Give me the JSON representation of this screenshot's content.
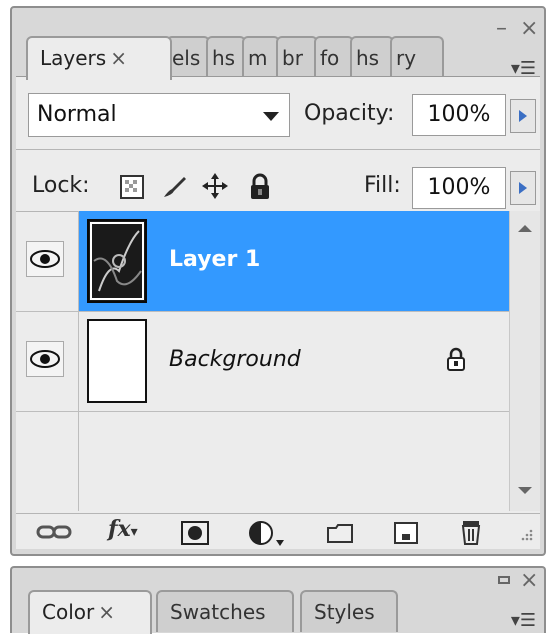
{
  "layers_panel": {
    "tabs": [
      {
        "label": "Layers",
        "active": true
      },
      {
        "label": "els"
      },
      {
        "label": "hs"
      },
      {
        "label": "m"
      },
      {
        "label": "br"
      },
      {
        "label": "fo"
      },
      {
        "label": "hs"
      },
      {
        "label": "ry"
      }
    ],
    "close_glyph": "×",
    "minimize_glyph": "–",
    "blend_mode": "Normal",
    "opacity_label": "Opacity:",
    "opacity_value": "100%",
    "lock_label": "Lock:",
    "fill_label": "Fill:",
    "fill_value": "100%",
    "layers": [
      {
        "name": "Layer 1",
        "selected": true,
        "visible": true,
        "locked": false
      },
      {
        "name": "Background",
        "selected": false,
        "visible": true,
        "locked": true
      }
    ],
    "bottom_icons": [
      "link-layers-icon",
      "fx-icon",
      "layer-mask-icon",
      "adjustment-layer-icon",
      "new-group-icon",
      "new-layer-icon",
      "trash-icon"
    ],
    "fx_label": "fx"
  },
  "color_panel": {
    "tabs": [
      {
        "label": "Color",
        "active": true
      },
      {
        "label": "Swatches"
      },
      {
        "label": "Styles"
      }
    ],
    "close_glyph": "×"
  },
  "colors": {
    "selection": "#3399ff",
    "panel_bg": "#ececec"
  }
}
